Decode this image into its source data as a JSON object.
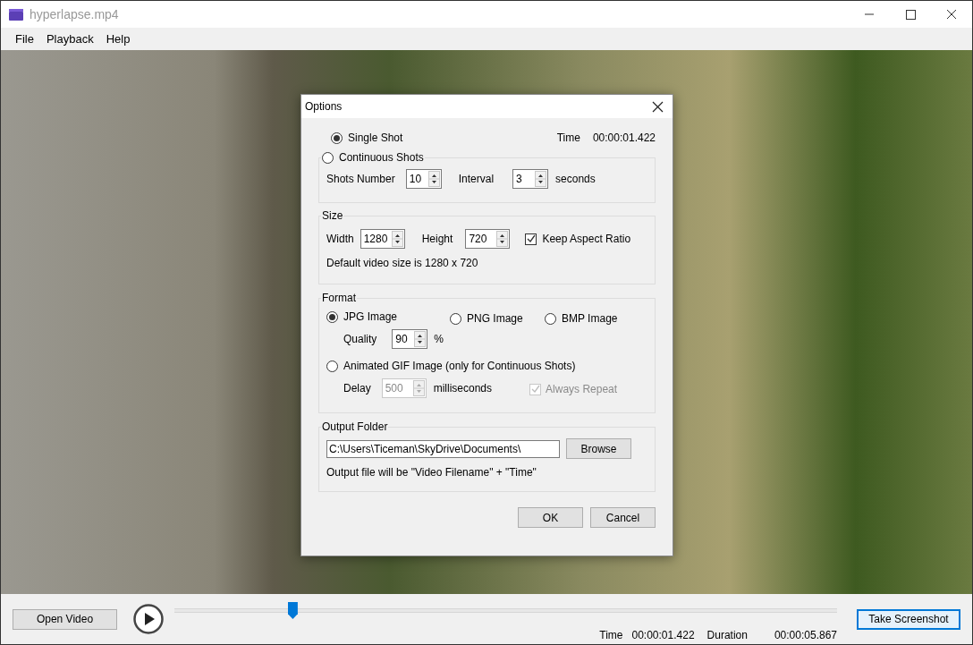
{
  "window": {
    "title": "hyperlapse.mp4"
  },
  "menu": [
    {
      "label": "File"
    },
    {
      "label": "Playback"
    },
    {
      "label": "Help"
    }
  ],
  "dialog": {
    "title": "Options",
    "single_shot": {
      "label": "Single Shot",
      "selected": true
    },
    "time_label": "Time",
    "time_value": "00:00:01.422",
    "continuous": {
      "label": "Continuous Shots",
      "selected": false,
      "shots_label": "Shots Number",
      "shots_value": "10",
      "interval_label": "Interval",
      "interval_value": "3",
      "unit": "seconds"
    },
    "size": {
      "title": "Size",
      "width_label": "Width",
      "width_value": "1280",
      "height_label": "Height",
      "height_value": "720",
      "keep_aspect": {
        "label": "Keep Aspect Ratio",
        "checked": true
      },
      "note": "Default video size is 1280 x 720"
    },
    "format": {
      "title": "Format",
      "options": [
        {
          "label": "JPG Image",
          "selected": true
        },
        {
          "label": "PNG Image",
          "selected": false
        },
        {
          "label": "BMP Image",
          "selected": false
        }
      ],
      "quality_label": "Quality",
      "quality_value": "90",
      "quality_unit": "%",
      "gif": {
        "label": "Animated GIF Image (only for Continuous Shots)",
        "selected": false,
        "delay_label": "Delay",
        "delay_value": "500",
        "delay_unit": "milliseconds",
        "disabled": true,
        "always_repeat": {
          "label": "Always Repeat",
          "checked": true,
          "disabled": true
        }
      }
    },
    "output": {
      "title": "Output Folder",
      "path": "C:\\Users\\Ticeman\\SkyDrive\\Documents\\",
      "browse": "Browse",
      "note": "Output file will be \"Video Filename\" + \"Time\""
    },
    "buttons": [
      {
        "label": "OK"
      },
      {
        "label": "Cancel"
      }
    ]
  },
  "player": {
    "open_button": "Open Video",
    "level": 0.178,
    "time_label": "Time",
    "time_value": "00:00:01.422",
    "duration_label": "Duration",
    "duration_value": "00:00:05.867",
    "screenshot_button": "Take Screenshot"
  }
}
